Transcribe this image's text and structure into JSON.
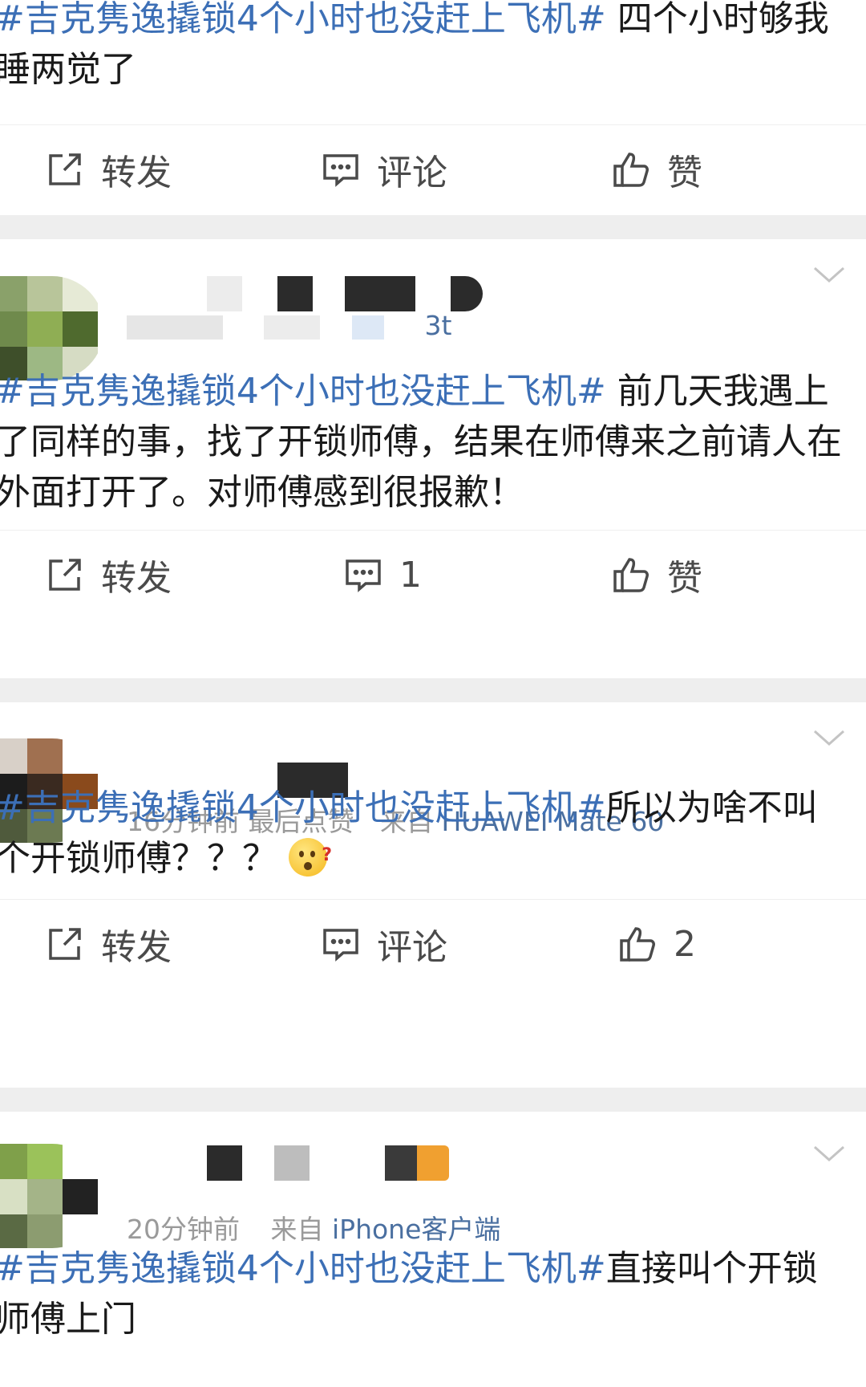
{
  "posts": [
    {
      "text_topic": "#吉克隽逸撬锁4个小时也没赶上飞机#",
      "text_body": " 四个小时够我睡两觉了",
      "actions": {
        "repost": "转发",
        "comment": "评论",
        "like": "赞"
      }
    },
    {
      "meta": {
        "time": "",
        "source": "3t"
      },
      "text_topic": "#吉克隽逸撬锁4个小时也没赶上飞机#",
      "text_body": " 前几天我遇上了同样的事，找了开锁师傅，结果在师傅来之前请人在外面打开了。对师傅感到很报歉！",
      "actions": {
        "repost": "转发",
        "comment": "1",
        "like": "赞"
      }
    },
    {
      "meta": {
        "time": "16分钟前 最后点赞",
        "from": "来自",
        "source": "HUAWEI Mate 60"
      },
      "text_topic": "#吉克隽逸撬锁4个小时也没赶上飞机#",
      "text_body": "所以为啥不叫个开锁师傅？？？",
      "emoji": "confused-face-emoji",
      "emoji_mark": "?",
      "actions": {
        "repost": "转发",
        "comment": "评论",
        "like": "2"
      }
    },
    {
      "meta": {
        "time": "20分钟前",
        "from": "来自",
        "source": "iPhone客户端"
      },
      "text_topic": "#吉克隽逸撬锁4个小时也没赶上飞机#",
      "text_body": "直接叫个开锁师傅上门"
    }
  ],
  "colors": {
    "topic": "#3c6fb6",
    "separator": "#eeeeee",
    "meta": "#9a9a9a",
    "action": "#4a4a4a"
  },
  "icons": [
    "repost-icon",
    "comment-icon",
    "like-icon",
    "chevron-down-icon"
  ]
}
